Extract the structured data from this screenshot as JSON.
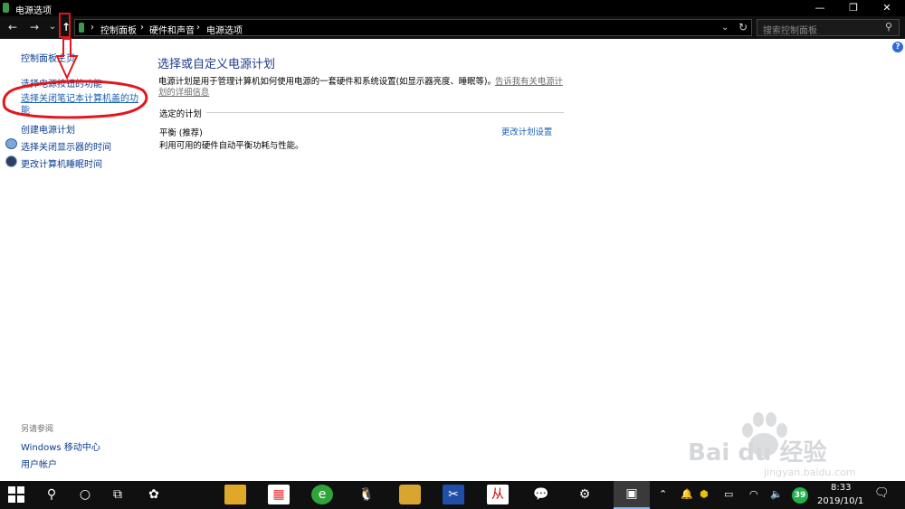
{
  "window": {
    "title": "电源选项",
    "minimize": "—",
    "maximize": "❐",
    "close": "✕"
  },
  "nav": {
    "back": "←",
    "forward": "→",
    "recent": "⌄",
    "up": "↑",
    "breadcrumb": [
      "控制面板",
      "硬件和声音",
      "电源选项"
    ],
    "sep": "›",
    "refresh": "↻",
    "search_placeholder": "搜索控制面板"
  },
  "sidebar": {
    "home": "控制面板主页",
    "items": [
      "选择电源按钮的功能",
      "选择关闭笔记本计算机盖的功能",
      "创建电源计划",
      "选择关闭显示器的时间",
      "更改计算机睡眠时间"
    ],
    "see_also_heading": "另请参阅",
    "see_also": [
      "Windows 移动中心",
      "用户帐户"
    ]
  },
  "main": {
    "title": "选择或自定义电源计划",
    "description": "电源计划是用于管理计算机如何使用电源的一套硬件和系统设置(如显示器亮度、睡眠等)。",
    "learn_more_1": "告诉我有关电源计",
    "learn_more_2": "划的详细信息",
    "section_heading": "选定的计划",
    "plan_name": "平衡 (推荐)",
    "plan_desc": "利用可用的硬件自动平衡功耗与性能。",
    "change_plan": "更改计划设置"
  },
  "taskbar": {
    "badge": "39",
    "time": "8:33",
    "date": "2019/10/1"
  },
  "watermark": {
    "text": "jingyan.baidu.com",
    "logo": "Bai du 经验"
  }
}
